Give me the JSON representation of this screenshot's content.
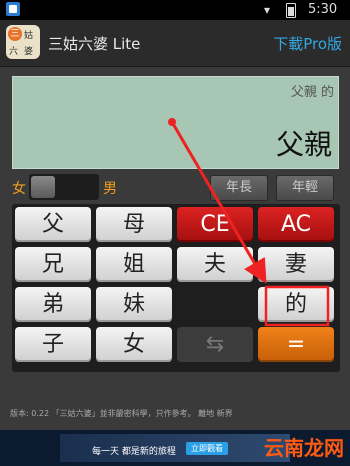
{
  "status_bar": {
    "time": "5:30",
    "wifi_icon": "wifi-icon",
    "battery_icon": "battery-icon",
    "notification_icon": "notification-icon"
  },
  "app_bar": {
    "icon_chars": [
      "三",
      "姑",
      "六",
      "婆"
    ],
    "title": "三姑六婆 Lite",
    "download_pro": "下載Pro版"
  },
  "display": {
    "expression": "父親 的",
    "result": "父親"
  },
  "gender": {
    "female": "女",
    "male": "男"
  },
  "age_buttons": {
    "older": "年長",
    "younger": "年輕"
  },
  "keys": {
    "father": "父",
    "mother": "母",
    "ce": "CE",
    "ac": "AC",
    "elder_brother": "兄",
    "elder_sister": "姐",
    "husband": "夫",
    "wife": "妻",
    "younger_brother": "弟",
    "younger_sister": "妹",
    "of": "的",
    "son": "子",
    "daughter": "女",
    "swap": "⇆",
    "equals": "="
  },
  "footer": "版本: 0.22 「三姑六婆」並非嚴密科學，只作參考。  離地 新界",
  "ad": {
    "text": "每一天 都是新的旅程",
    "button": "立即觀看"
  },
  "watermark": "云南龙网",
  "colors": {
    "accent_orange": "#f0a020",
    "pro_blue": "#33a8e0",
    "key_red": "#cc2222",
    "key_orange": "#e8761a",
    "annotation_red": "#ee2222"
  }
}
